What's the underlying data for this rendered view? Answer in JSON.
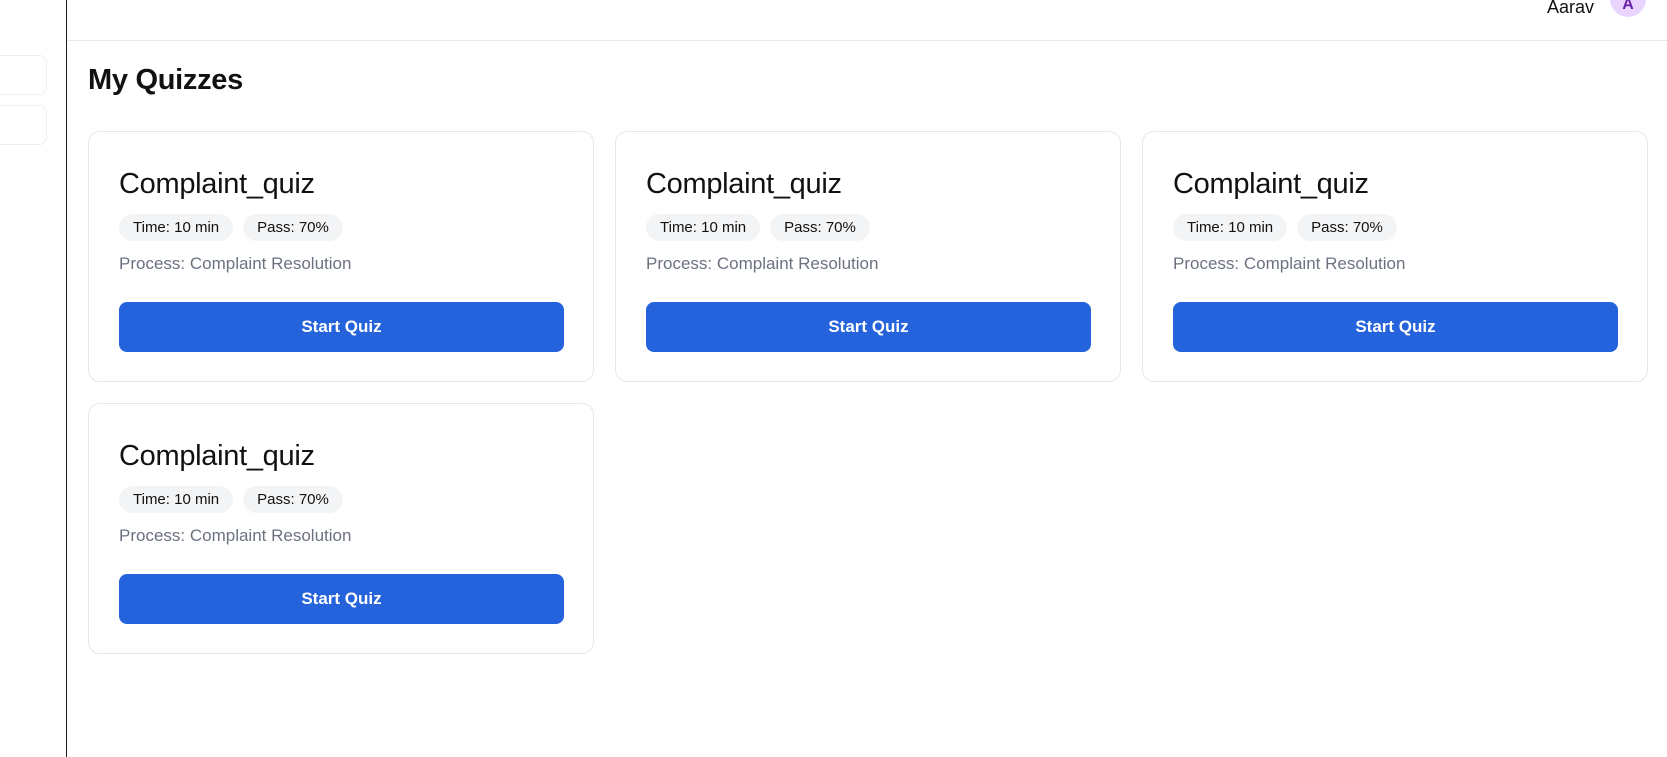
{
  "header": {
    "user_name": "Aarav",
    "avatar_initial": "A"
  },
  "page": {
    "title": "My Quizzes"
  },
  "quizzes": [
    {
      "title": "Complaint_quiz",
      "time": "Time: 10 min",
      "pass": "Pass: 70%",
      "process": "Process: Complaint Resolution",
      "button": "Start Quiz"
    },
    {
      "title": "Complaint_quiz",
      "time": "Time: 10 min",
      "pass": "Pass: 70%",
      "process": "Process: Complaint Resolution",
      "button": "Start Quiz"
    },
    {
      "title": "Complaint_quiz",
      "time": "Time: 10 min",
      "pass": "Pass: 70%",
      "process": "Process: Complaint Resolution",
      "button": "Start Quiz"
    },
    {
      "title": "Complaint_quiz",
      "time": "Time: 10 min",
      "pass": "Pass: 70%",
      "process": "Process: Complaint Resolution",
      "button": "Start Quiz"
    }
  ],
  "colors": {
    "primary_button": "#2563dc",
    "avatar_bg": "#e9d5ff",
    "badge_bg": "#f3f4f6",
    "muted_text": "#6b7280"
  }
}
